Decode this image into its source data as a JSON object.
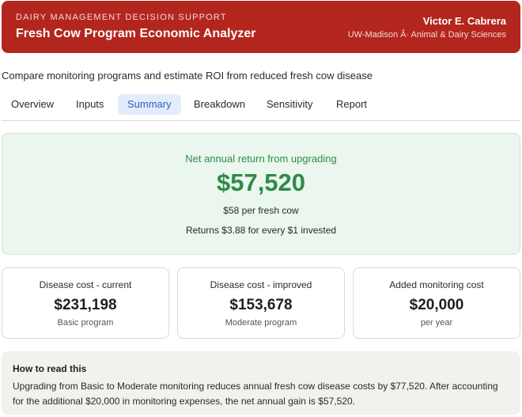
{
  "header": {
    "eyebrow": "DAIRY MANAGEMENT DECISION SUPPORT",
    "title": "Fresh Cow Program Economic Analyzer",
    "author": "Victor E. Cabrera",
    "affiliation": "UW-Madison Â· Animal & Dairy Sciences",
    "background_color": "#b3261e"
  },
  "subtitle": "Compare monitoring programs and estimate ROI from reduced fresh cow disease",
  "tabs": [
    {
      "label": "Overview",
      "active": false
    },
    {
      "label": "Inputs",
      "active": false
    },
    {
      "label": "Summary",
      "active": true
    },
    {
      "label": "Breakdown",
      "active": false
    },
    {
      "label": "Sensitivity",
      "active": false
    },
    {
      "label": "Report",
      "active": false
    }
  ],
  "hero": {
    "label": "Net annual return from upgrading",
    "value": "$57,520",
    "per_cow": "$58 per fresh cow",
    "roi": "Returns $3.88 for every $1 invested",
    "accent_color": "#2e8b47"
  },
  "cards": [
    {
      "label": "Disease cost - current",
      "value": "$231,198",
      "sub": "Basic program"
    },
    {
      "label": "Disease cost - improved",
      "value": "$153,678",
      "sub": "Moderate program"
    },
    {
      "label": "Added monitoring cost",
      "value": "$20,000",
      "sub": "per year"
    }
  ],
  "howto": {
    "title": "How to read this",
    "body": "Upgrading from Basic to Moderate monitoring reduces annual fresh cow disease costs by $77,520. After accounting for the additional $20,000 in monitoring expenses, the net annual gain is $57,520."
  }
}
